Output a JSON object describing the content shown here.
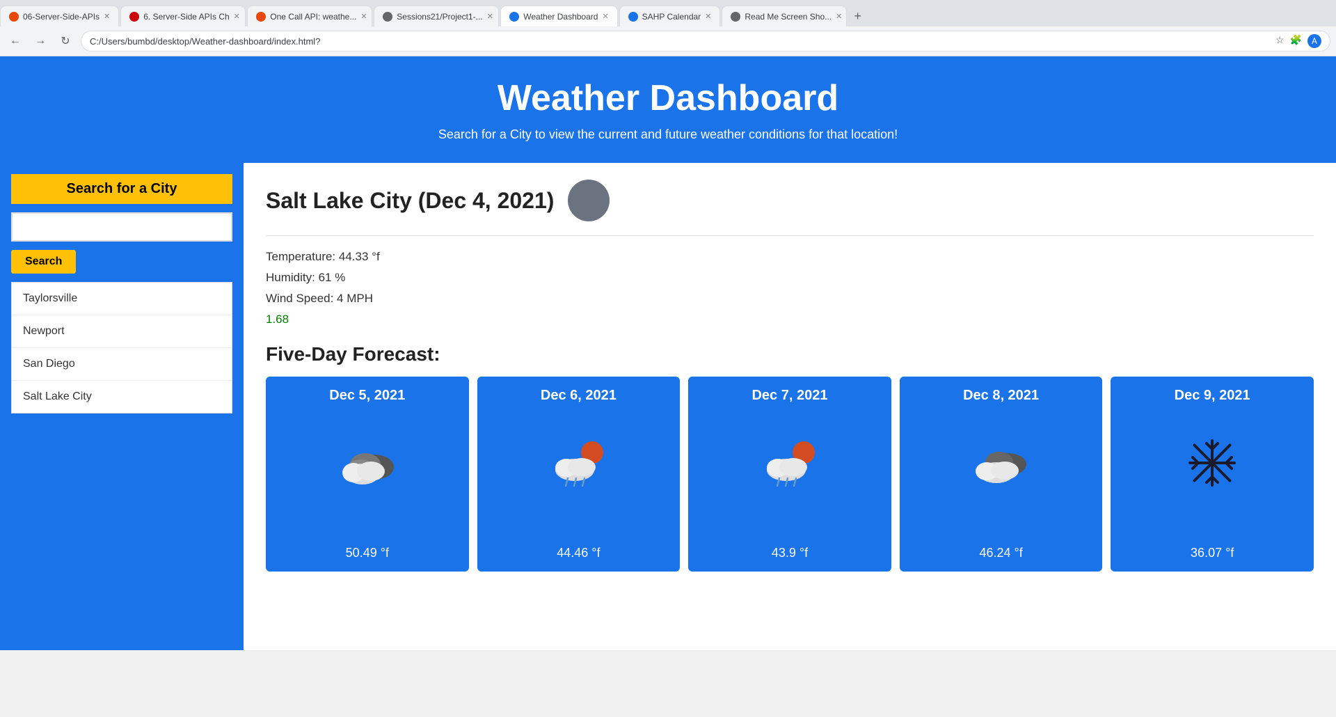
{
  "browser": {
    "address": "C:/Users/bumbd/desktop/Weather-dashboard/index.html?",
    "tabs": [
      {
        "label": "06-Server-Side-APIs",
        "active": false,
        "color": "#e8470a"
      },
      {
        "label": "6. Server-Side APIs Ch",
        "active": false,
        "color": "#cc0000"
      },
      {
        "label": "One Call API: weathe...",
        "active": false,
        "color": "#e8470a"
      },
      {
        "label": "Sessions21/Project1-...",
        "active": false,
        "color": "#666"
      },
      {
        "label": "Weather Dashboard",
        "active": true,
        "color": "#1a73e8"
      },
      {
        "label": "SAHP Calendar",
        "active": false,
        "color": "#1a73e8"
      },
      {
        "label": "Read Me Screen Sho...",
        "active": false,
        "color": "#666"
      }
    ]
  },
  "header": {
    "title": "Weather Dashboard",
    "subtitle": "Search for a City to view the current and future weather conditions for that location!"
  },
  "sidebar": {
    "search_title": "Search for a City",
    "search_placeholder": "",
    "search_button": "Search",
    "cities": [
      {
        "name": "Taylorsville"
      },
      {
        "name": "Newport"
      },
      {
        "name": "San Diego"
      },
      {
        "name": "Salt Lake City"
      }
    ]
  },
  "current_weather": {
    "city": "Salt Lake City",
    "date": "Dec 4, 2021",
    "temperature": "Temperature: 44.33 °f",
    "humidity": "Humidity: 61 %",
    "wind_speed": "Wind Speed: 4 MPH",
    "uv_index": "1.68"
  },
  "forecast": {
    "title": "Five-Day Forecast:",
    "days": [
      {
        "date": "Dec 5, 2021",
        "temp": "50.49 °f",
        "icon": "cloud_dark"
      },
      {
        "date": "Dec 6, 2021",
        "temp": "44.46 °f",
        "icon": "cloud_rain_sun"
      },
      {
        "date": "Dec 7, 2021",
        "temp": "43.9 °f",
        "icon": "cloud_rain_sun"
      },
      {
        "date": "Dec 8, 2021",
        "temp": "46.24 °f",
        "icon": "cloud_dark"
      },
      {
        "date": "Dec 9, 2021",
        "temp": "36.07 °f",
        "icon": "snow"
      }
    ]
  }
}
